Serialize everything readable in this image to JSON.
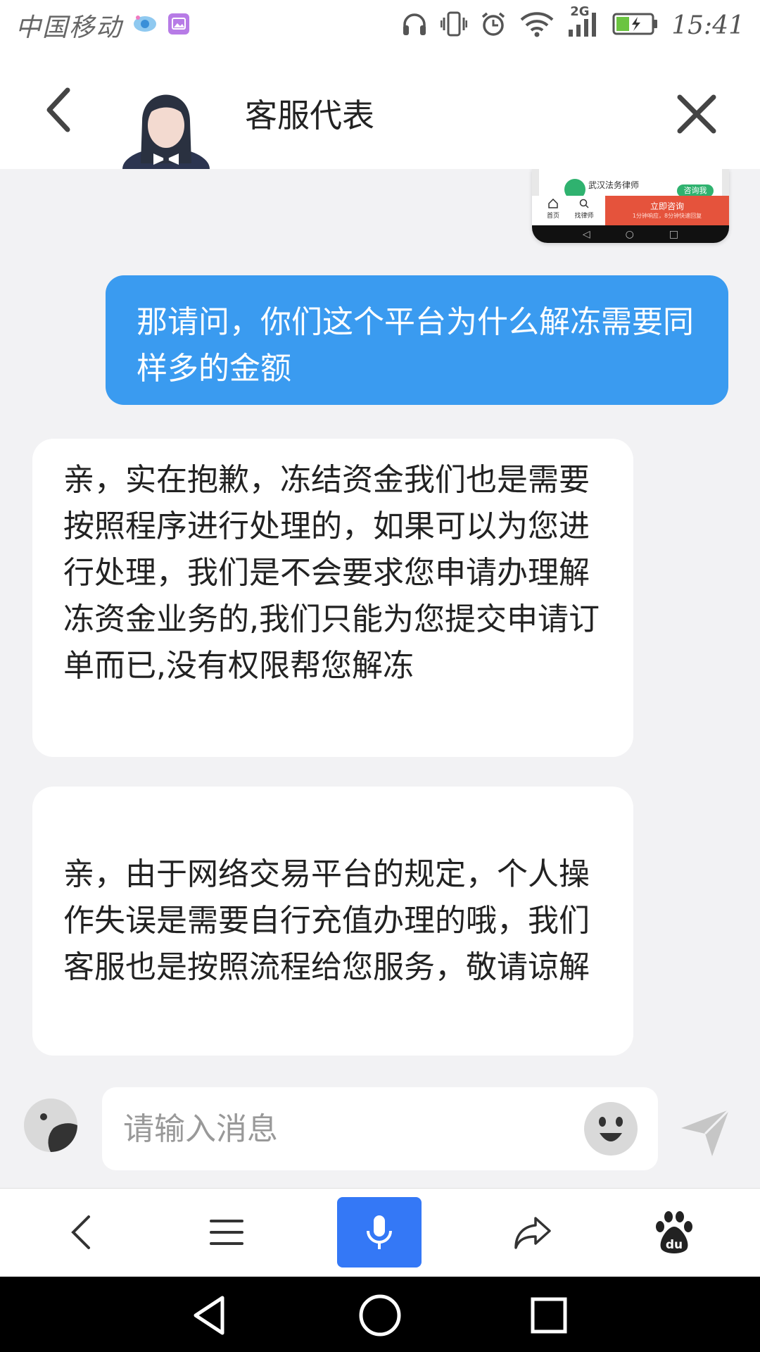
{
  "status_bar": {
    "carrier": "中国移动",
    "network_label": "2G",
    "time": "15:41",
    "icons": [
      "app-eye-icon",
      "gallery-icon",
      "headphones-icon",
      "vibrate-icon",
      "alarm-icon",
      "wifi-icon",
      "signal-icon",
      "battery-charging-icon"
    ]
  },
  "header": {
    "title": "客服代表",
    "back_icon": "chevron-left-icon",
    "close_icon": "close-icon",
    "avatar": "agent-avatar"
  },
  "thumbnail": {
    "lawyer_label": "武汉法务律师",
    "tag": "咨询我",
    "tab_home": "首页",
    "tab_find": "找律师",
    "consult_button": "立即咨询",
    "consult_sub": "1分钟响应，8分钟快速回复"
  },
  "messages": [
    {
      "sender": "user",
      "text": "那请问，你们这个平台为什么解冻需要同样多的金额"
    },
    {
      "sender": "agent",
      "text": "亲，实在抱歉，冻结资金我们也是需要按照程序进行处理的，如果可以为您进行处理，我们是不会要求您申请办理解冻资金业务的,我们只能为您提交申请订单而已,没有权限帮您解冻"
    },
    {
      "sender": "agent",
      "text": "亲，由于网络交易平台的规定，个人操作失误是需要自行充值办理的哦，我们客服也是按照流程给您服务，敬请谅解"
    }
  ],
  "composer": {
    "placeholder": "请输入消息",
    "value": "",
    "left_icon": "sticker-icon",
    "emoji_icon": "emoji-icon",
    "send_icon": "send-icon"
  },
  "browser_toolbar": {
    "items": [
      "back-icon",
      "menu-icon",
      "microphone-icon",
      "share-icon",
      "baidu-paw-icon"
    ],
    "mic_color": "#3478f6",
    "baidu_label": "du"
  },
  "colors": {
    "user_bubble": "#3a9bf0",
    "agent_bubble": "#ffffff",
    "chat_background": "#f2f2f4"
  }
}
